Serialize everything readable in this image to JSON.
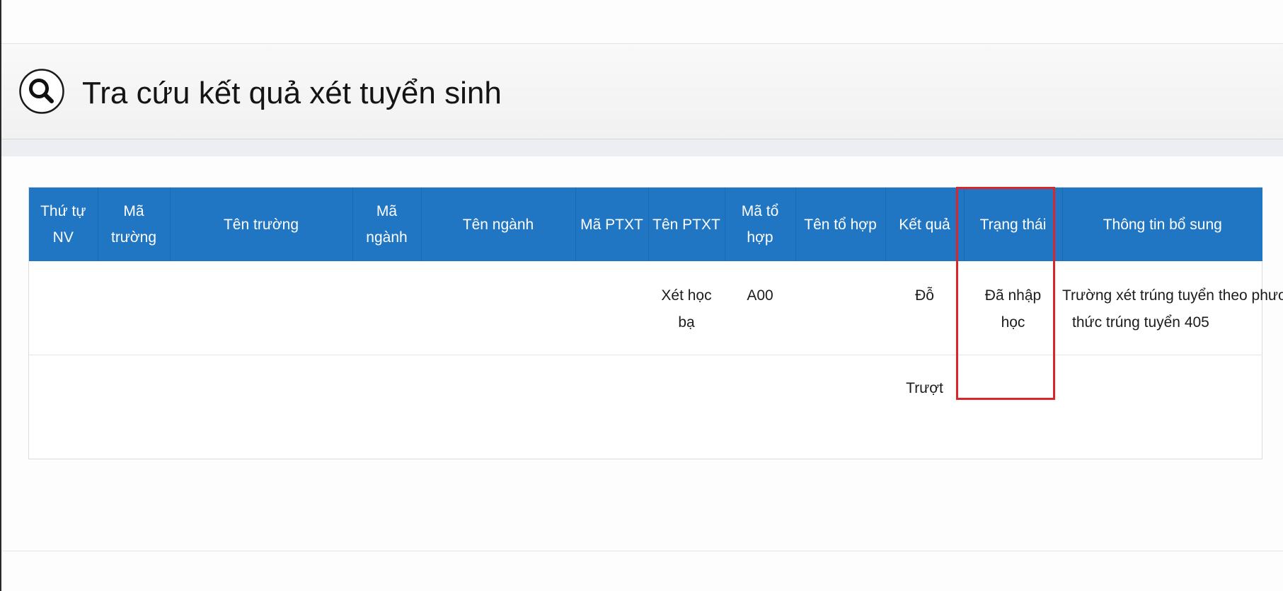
{
  "header": {
    "title": "Tra cứu kết quả xét tuyển sinh",
    "icon": "search-icon"
  },
  "table": {
    "columns": [
      "Thứ tự NV",
      "Mã trường",
      "Tên trường",
      "Mã ngành",
      "Tên ngành",
      "Mã PTXT",
      "Tên PTXT",
      "Mã tổ hợp",
      "Tên tổ hợp",
      "Kết quả",
      "Trạng thái",
      "Thông tin bổ sung"
    ],
    "rows": [
      {
        "thu_tu_nv": "",
        "ma_truong": "",
        "ten_truong": "",
        "ma_nganh": "",
        "ten_nganh": "",
        "ma_ptxt": "",
        "ten_ptxt": "Xét học bạ",
        "ma_to_hop": "A00",
        "ten_to_hop": "",
        "ket_qua": "Đỗ",
        "trang_thai": "Đã nhập học",
        "thong_tin_bo_sung_line1": "Trường xét trúng tuyển theo phương",
        "thong_tin_bo_sung_line2": "thức trúng tuyển 405"
      },
      {
        "thu_tu_nv": "",
        "ma_truong": "",
        "ten_truong": "",
        "ma_nganh": "",
        "ten_nganh": "",
        "ma_ptxt": "",
        "ten_ptxt": "",
        "ma_to_hop": "",
        "ten_to_hop": "",
        "ket_qua": "Trượt",
        "trang_thai": "",
        "thong_tin_bo_sung_line1": "",
        "thong_tin_bo_sung_line2": ""
      }
    ]
  },
  "colors": {
    "header_blue": "#2076c2",
    "highlight_red": "#d8262b"
  }
}
